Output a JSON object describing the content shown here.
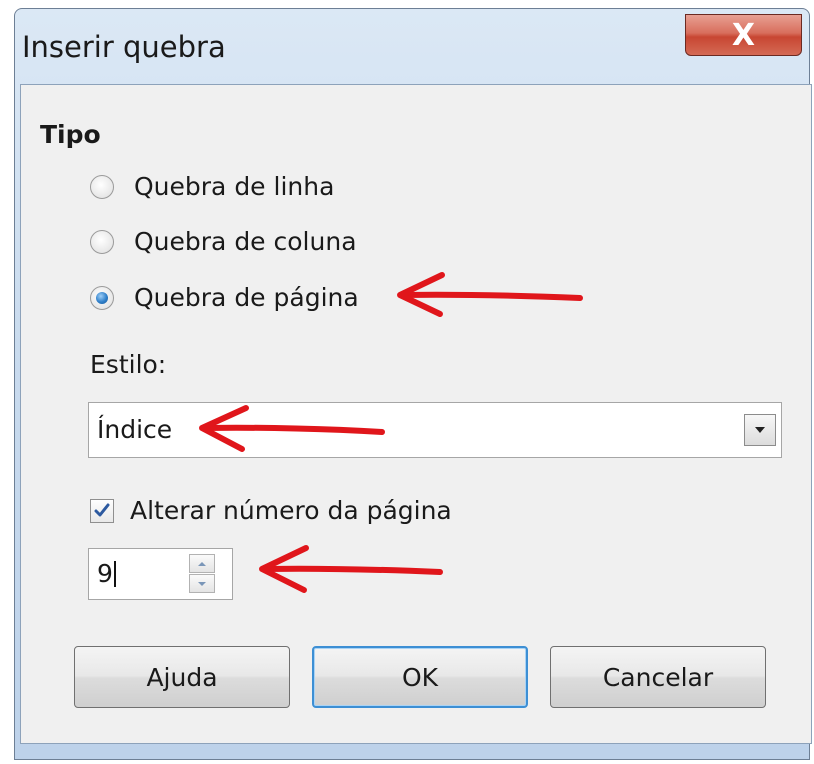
{
  "dialog": {
    "title": "Inserir quebra",
    "close_label": "X"
  },
  "type_group": {
    "label": "Tipo",
    "options": [
      {
        "label": "Quebra de linha",
        "checked": false
      },
      {
        "label": "Quebra de coluna",
        "checked": false
      },
      {
        "label": "Quebra de página",
        "checked": true
      }
    ]
  },
  "style": {
    "label": "Estilo:",
    "value": "Índice"
  },
  "page_number": {
    "checkbox_label": "Alterar número da página",
    "checked": true,
    "value": "9"
  },
  "buttons": {
    "help": "Ajuda",
    "ok": "OK",
    "cancel": "Cancelar"
  },
  "icons": [
    "close-icon",
    "dropdown-arrow-icon",
    "checkmark-icon",
    "spin-up-icon",
    "spin-down-icon",
    "annotation-arrow-icon"
  ],
  "colors": {
    "annotation": "#e0161b",
    "accent": "#3d8fd4"
  }
}
